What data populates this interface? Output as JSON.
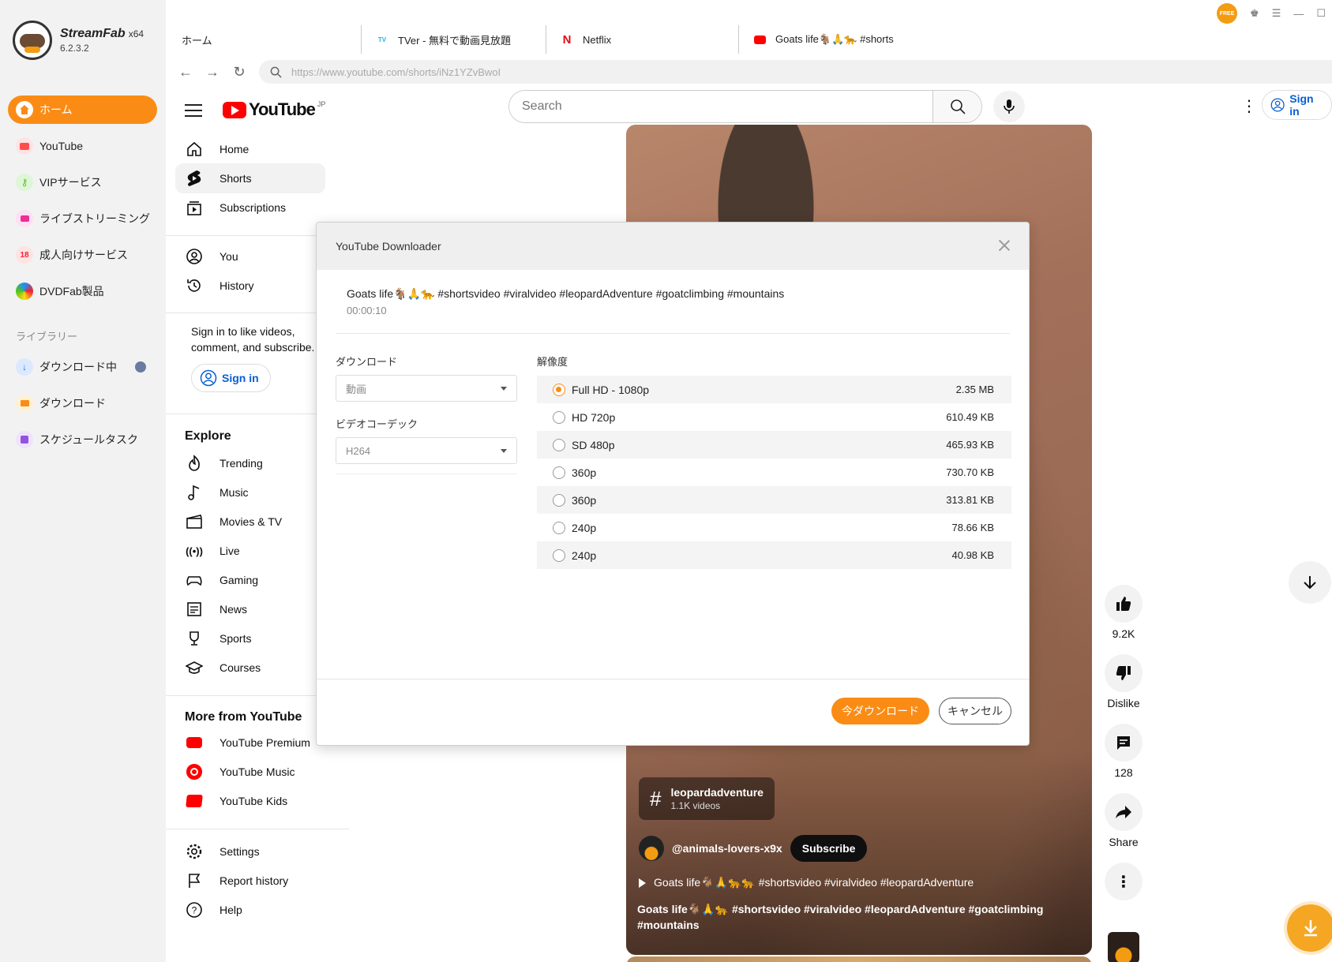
{
  "app": {
    "name": "StreamFab",
    "arch": "x64",
    "version": "6.2.3.2",
    "accent": "#fa8c16"
  },
  "sidebar": {
    "items": [
      {
        "label": "ホーム",
        "icon": "home-icon",
        "active": true
      },
      {
        "label": "YouTube",
        "icon": "youtube-icon"
      },
      {
        "label": "VIPサービス",
        "icon": "key-icon"
      },
      {
        "label": "ライブストリーミング",
        "icon": "camera-icon"
      },
      {
        "label": "成人向けサービス",
        "icon": "adult-icon"
      },
      {
        "label": "DVDFab製品",
        "icon": "dvdfab-icon"
      }
    ],
    "library_title": "ライブラリー",
    "library": [
      {
        "label": "ダウンロード中",
        "icon": "downloading-icon"
      },
      {
        "label": "ダウンロード",
        "icon": "folder-icon"
      },
      {
        "label": "スケジュールタスク",
        "icon": "schedule-icon"
      }
    ]
  },
  "tabs": [
    {
      "label": "ホーム"
    },
    {
      "label": "TVer - 無料で動画見放題",
      "icon": "tver-icon"
    },
    {
      "label": "Netflix",
      "icon": "netflix-icon"
    },
    {
      "label": "Goats life🐐🙏🐆 #shorts",
      "icon": "youtube-icon",
      "active": true
    }
  ],
  "window": {
    "free_badge": "FREE"
  },
  "address_bar": {
    "url": "https://www.youtube.com/shorts/iNz1YZvBwoI"
  },
  "youtube": {
    "logo_text": "YouTube",
    "logo_region": "JP",
    "search_placeholder": "Search",
    "sign_in": "Sign in",
    "guide": {
      "main": [
        "Home",
        "Shorts",
        "Subscriptions"
      ],
      "you": [
        "You",
        "History"
      ],
      "signin_note": "Sign in to like videos, comment, and subscribe.",
      "signin_btn": "Sign in",
      "explore_title": "Explore",
      "explore": [
        "Trending",
        "Music",
        "Movies & TV",
        "Live",
        "Gaming",
        "News",
        "Sports",
        "Courses"
      ],
      "more_title": "More from YouTube",
      "more": [
        "YouTube Premium",
        "YouTube Music",
        "YouTube Kids"
      ],
      "footer": [
        "Settings",
        "Report history",
        "Help"
      ]
    },
    "short": {
      "hashtag": "leopardadventure",
      "hashtag_count": "1.1K videos",
      "channel": "@animals-lovers-x9x",
      "subscribe": "Subscribe",
      "audio": "Goats life🐐🙏🐆🐆   #shortsvideo #viralvideo #leopardAdventure",
      "description": "Goats life🐐🙏🐆   #shortsvideo #viralvideo #leopardAdventure  #goatclimbing #mountains",
      "likes": "9.2K",
      "dislike": "Dislike",
      "comments": "128",
      "share": "Share"
    }
  },
  "modal": {
    "title": "YouTube Downloader",
    "video_title": "Goats life🐐🙏🐆   #shortsvideo #viralvideo #leopardAdventure  #goatclimbing #mountains",
    "duration": "00:00:10",
    "download_label": "ダウンロード",
    "download_value": "動画",
    "codec_label": "ビデオコーデック",
    "codec_value": "H264",
    "resolution_label": "解像度",
    "resolutions": [
      {
        "label": "Full HD - 1080p",
        "size": "2.35 MB",
        "selected": true
      },
      {
        "label": "HD 720p",
        "size": "610.49 KB"
      },
      {
        "label": "SD 480p",
        "size": "465.93 KB"
      },
      {
        "label": "360p",
        "size": "730.70 KB"
      },
      {
        "label": "360p",
        "size": "313.81 KB"
      },
      {
        "label": "240p",
        "size": "78.66 KB"
      },
      {
        "label": "240p",
        "size": "40.98 KB"
      }
    ],
    "download_btn": "今ダウンロード",
    "cancel_btn": "キャンセル"
  }
}
